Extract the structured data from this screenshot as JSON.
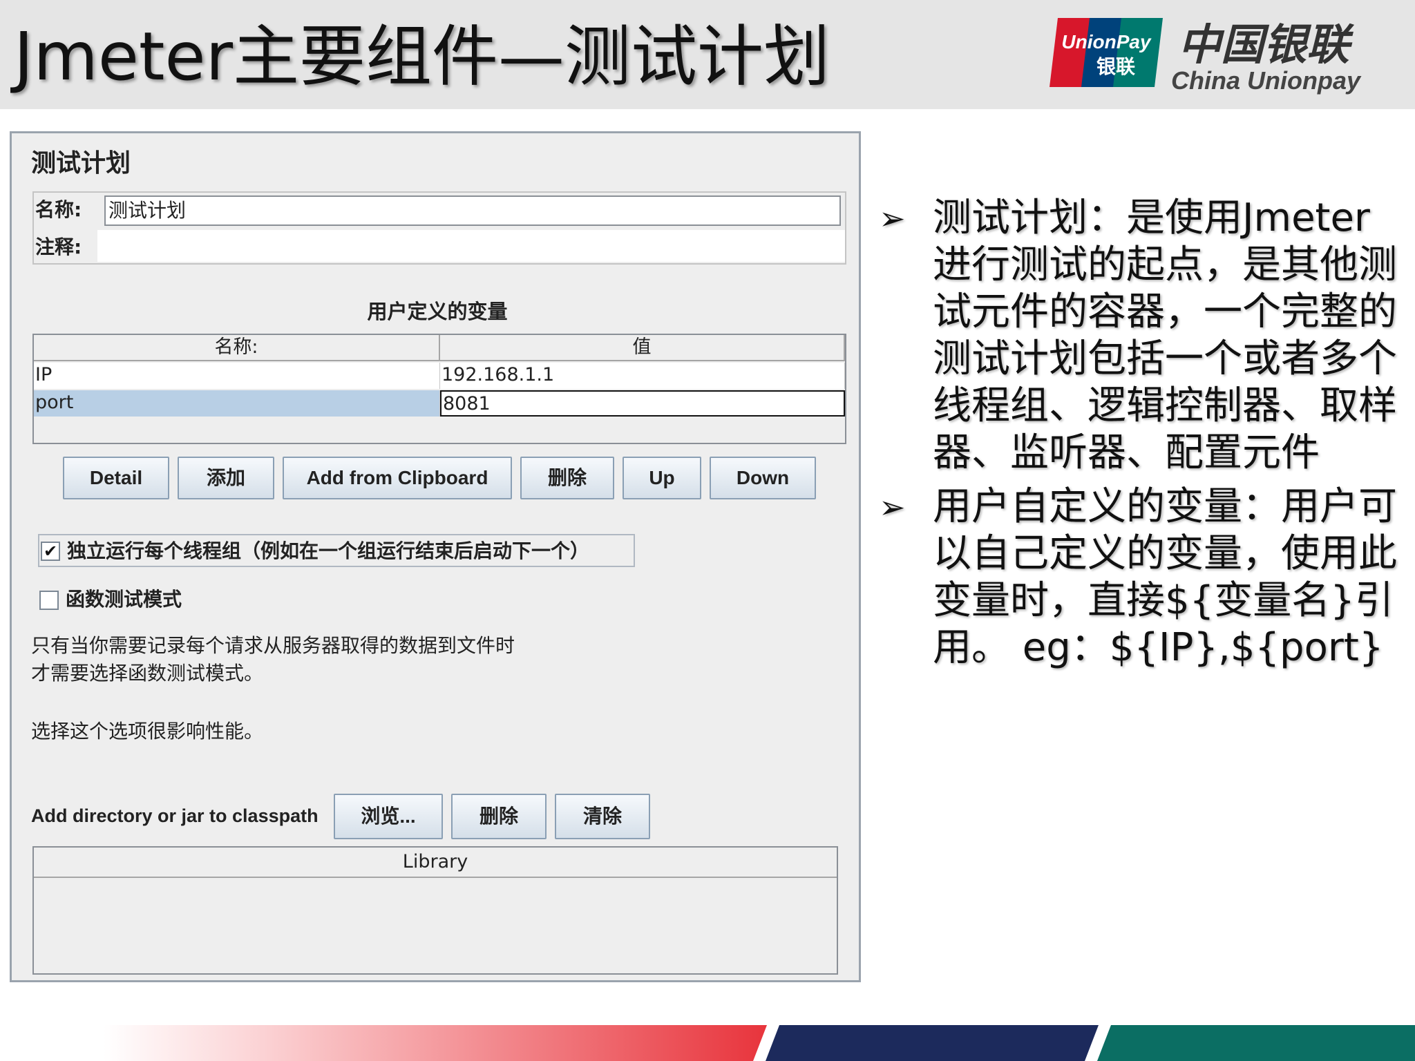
{
  "slide": {
    "title": "Jmeter主要组件—测试计划",
    "brand": {
      "logo_text_en": "UnionPay",
      "logo_text_cn": "银联",
      "name_cn": "中国银联",
      "name_en": "China Unionpay",
      "colors": [
        "#d7172b",
        "#00427b",
        "#00796e"
      ]
    }
  },
  "panel": {
    "title": "测试计划",
    "name_label": "名称:",
    "name_value": "测试计划",
    "comment_label": "注释:",
    "comment_value": "",
    "vars_title": "用户定义的变量",
    "vars_headers": [
      "名称:",
      "值"
    ],
    "vars_rows": [
      {
        "name": "IP",
        "value": "192.168.1.1"
      },
      {
        "name": "port",
        "value": "8081"
      }
    ],
    "buttons": [
      "Detail",
      "添加",
      "Add from Clipboard",
      "删除",
      "Up",
      "Down"
    ],
    "checkbox_thread": {
      "label": "独立运行每个线程组（例如在一个组运行结束后启动下一个）",
      "checked": true
    },
    "checkbox_func": {
      "label": "函数测试模式",
      "checked": false
    },
    "notes": [
      "只有当你需要记录每个请求从服务器取得的数据到文件时",
      "才需要选择函数测试模式。",
      "选择这个选项很影响性能。"
    ],
    "classpath_label": "Add directory or jar to classpath",
    "classpath_buttons": [
      "浏览...",
      "删除",
      "清除"
    ],
    "library_header": "Library"
  },
  "bullets": [
    "测试计划：是使用Jmeter进行测试的起点，是其他测试元件的容器，一个完整的测试计划包括一个或者多个线程组、逻辑控制器、取样器、监听器、配置元件",
    "用户自定义的变量：用户可以自己定义的变量，使用此变量时，直接${变量名}引用。 eg：${IP},${port}"
  ]
}
